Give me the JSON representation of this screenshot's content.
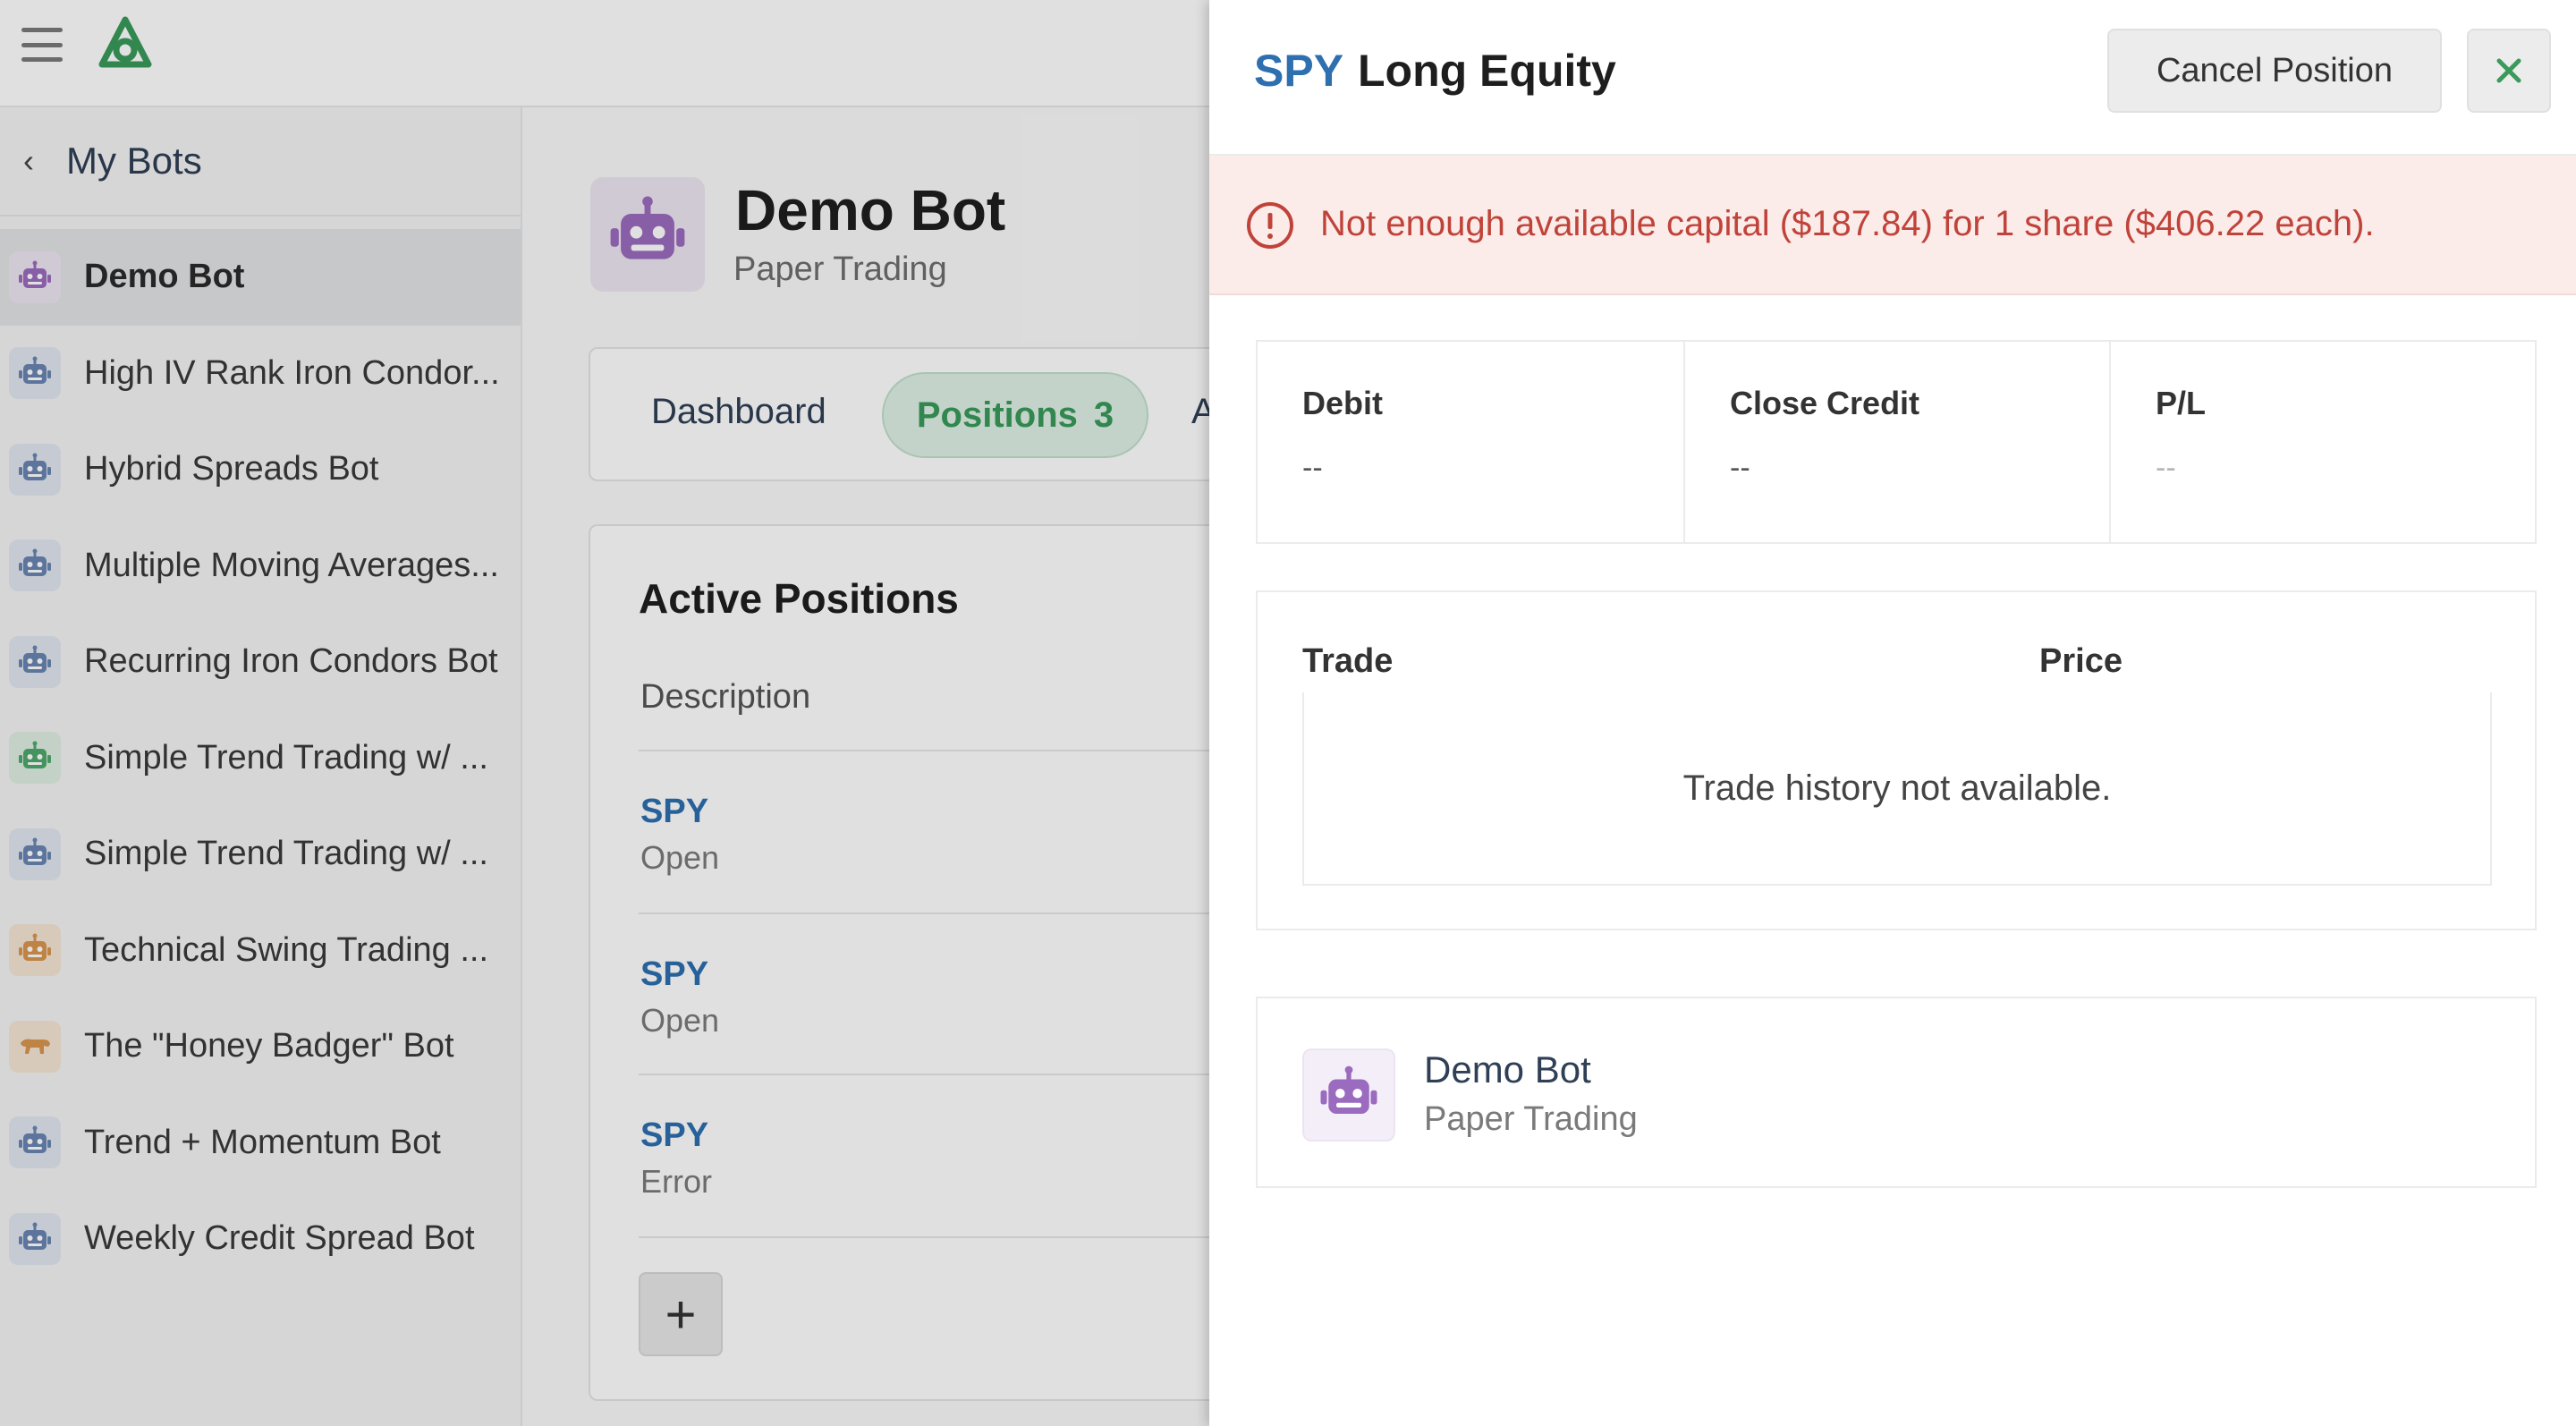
{
  "background": {
    "sidebar": {
      "back_label": "My Bots",
      "items": [
        {
          "label": "Demo Bot",
          "active": true,
          "icon": "robot-icon",
          "color": "#9b6bbf",
          "bg": "#ede6f3"
        },
        {
          "label": "High IV Rank Iron Condor...",
          "icon": "robot-icon",
          "color": "#6a86b3",
          "bg": "#e2e8f1"
        },
        {
          "label": "Hybrid Spreads Bot",
          "icon": "robot-icon",
          "color": "#6a86b3",
          "bg": "#e2e8f1"
        },
        {
          "label": "Multiple Moving Averages...",
          "icon": "robot-icon",
          "color": "#6a86b3",
          "bg": "#e2e8f1"
        },
        {
          "label": "Recurring Iron Condors Bot",
          "icon": "robot-icon",
          "color": "#6a86b3",
          "bg": "#e2e8f1"
        },
        {
          "label": "Simple Trend Trading w/ ...",
          "icon": "robot-icon",
          "color": "#4fa86b",
          "bg": "#dfeee3"
        },
        {
          "label": "Simple Trend Trading w/ ...",
          "icon": "robot-icon",
          "color": "#6a86b3",
          "bg": "#e2e8f1"
        },
        {
          "label": "Technical Swing Trading ...",
          "icon": "robot-icon",
          "color": "#d9964f",
          "bg": "#f5e6d5"
        },
        {
          "label": "The \"Honey Badger\" Bot",
          "icon": "badger-icon",
          "color": "#d9964f",
          "bg": "#f5e6d5"
        },
        {
          "label": "Trend + Momentum Bot",
          "icon": "robot-icon",
          "color": "#6a86b3",
          "bg": "#e2e8f1"
        },
        {
          "label": "Weekly Credit Spread Bot",
          "icon": "robot-icon",
          "color": "#6a86b3",
          "bg": "#e2e8f1"
        }
      ]
    },
    "main": {
      "bot_title": "Demo Bot",
      "bot_subtitle": "Paper Trading",
      "tabs": {
        "dashboard": "Dashboard",
        "positions": "Positions",
        "positions_count": "3",
        "more": "A"
      },
      "positions_card": {
        "title": "Active Positions",
        "description_header": "Description",
        "rows": [
          {
            "symbol": "SPY",
            "status": "Open"
          },
          {
            "symbol": "SPY",
            "status": "Open"
          },
          {
            "symbol": "SPY",
            "status": "Error"
          }
        ],
        "add_label": "+"
      }
    }
  },
  "panel": {
    "symbol": "SPY",
    "title": "Long Equity",
    "cancel_label": "Cancel Position",
    "close_icon": "close-icon",
    "error_message": "Not enough available capital ($187.84) for 1 share ($406.22 each).",
    "stats": {
      "debit_label": "Debit",
      "debit_value": "--",
      "close_credit_label": "Close Credit",
      "close_credit_value": "--",
      "pl_label": "P/L",
      "pl_value": "--"
    },
    "trades": {
      "trade_header": "Trade",
      "price_header": "Price",
      "empty_message": "Trade history not available."
    },
    "bot": {
      "name": "Demo Bot",
      "subtitle": "Paper Trading"
    }
  },
  "colors": {
    "symbol_blue": "#2e6fb0",
    "error_red": "#c0433a",
    "close_green": "#3a9a5a",
    "bot_purple": "#9b6bbf"
  }
}
